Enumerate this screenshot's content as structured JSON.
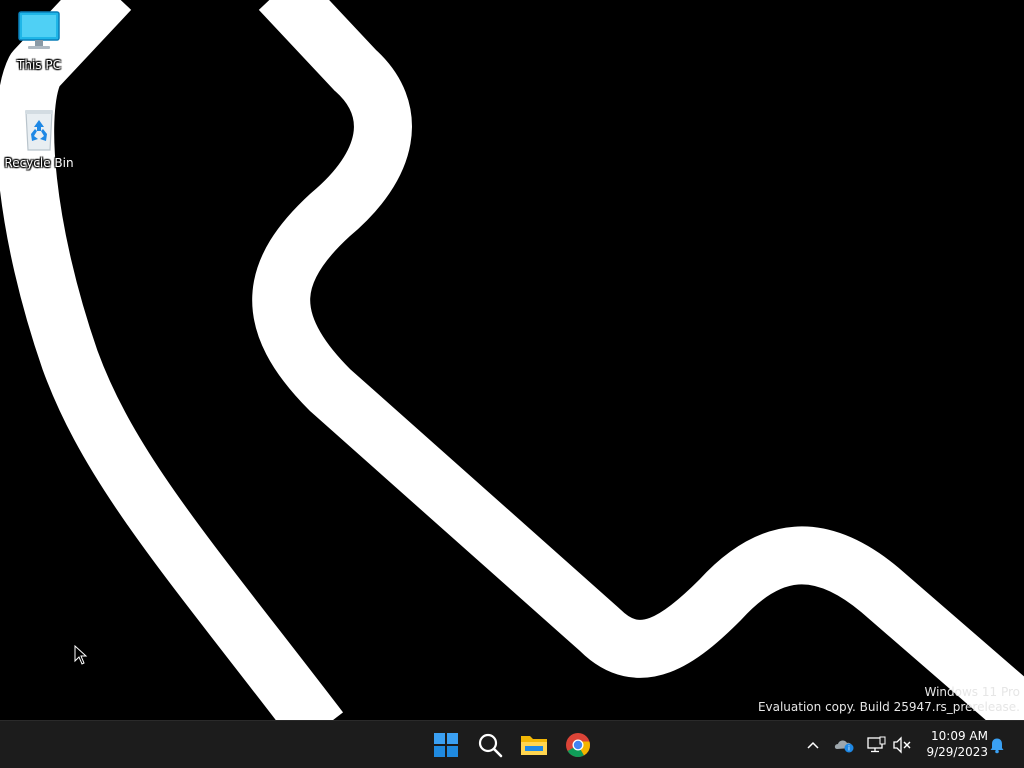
{
  "desktop": {
    "icons": [
      {
        "label": "This PC",
        "icon": "monitor-icon"
      },
      {
        "label": "Recycle Bin",
        "icon": "recycle-bin-icon"
      }
    ],
    "watermark": {
      "line1": "Windows 11 Pro",
      "line2": "Evaluation copy. Build 25947.rs_prerelease."
    }
  },
  "taskbar": {
    "pinned": [
      {
        "name": "Start",
        "icon": "windows-logo-icon"
      },
      {
        "name": "Search",
        "icon": "search-icon"
      },
      {
        "name": "File Explorer",
        "icon": "folder-icon"
      },
      {
        "name": "Google Chrome",
        "icon": "chrome-icon"
      }
    ],
    "tray": {
      "icons": [
        "chevron-up-icon",
        "onedrive-icon",
        "network-icon",
        "volume-muted-icon",
        "notification-bell-icon"
      ],
      "time": "10:09 AM",
      "date": "9/29/2023"
    }
  },
  "colors": {
    "desktop_bg": "#000000",
    "wallpaper_stroke": "#ffffff",
    "taskbar_bg": "#1c1c1c",
    "accent": "#0078d4"
  }
}
